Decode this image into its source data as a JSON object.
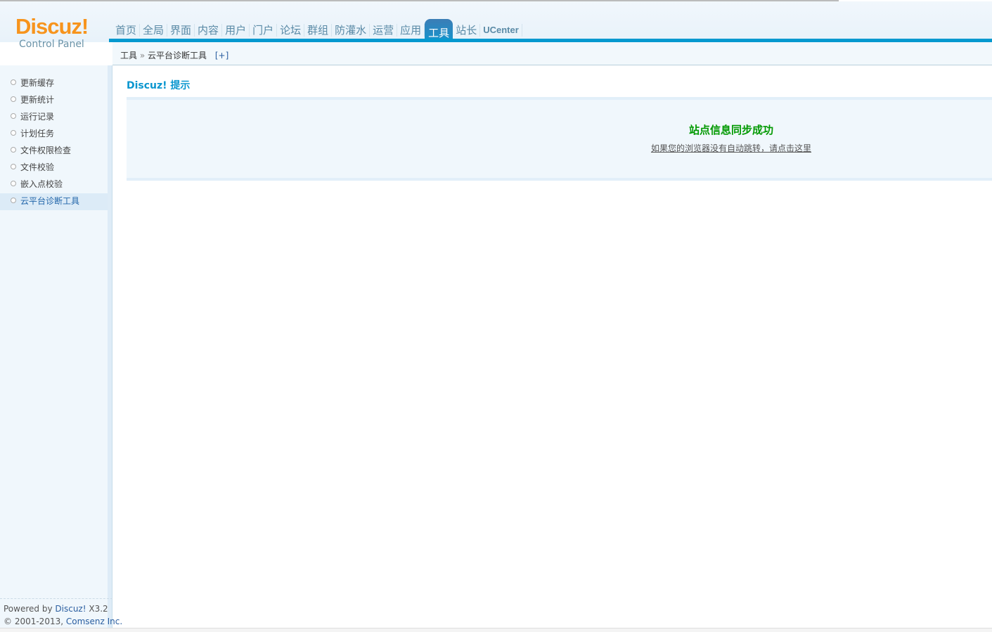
{
  "logo": {
    "brand": "Discuz!",
    "subtitle": "Control Panel"
  },
  "nav": {
    "items": [
      "首页",
      "全局",
      "界面",
      "内容",
      "用户",
      "门户",
      "论坛",
      "群组",
      "防灌水",
      "运营",
      "应用",
      "工具",
      "站长"
    ],
    "ucenter": "UCenter",
    "active": "工具"
  },
  "breadcrumb": {
    "section": "工具",
    "separator": "»",
    "current": "云平台诊断工具",
    "expand": "[+]"
  },
  "sidebar": {
    "items": [
      "更新缓存",
      "更新统计",
      "运行记录",
      "计划任务",
      "文件权限检查",
      "文件校验",
      "嵌入点校验",
      "云平台诊断工具"
    ],
    "active_index": 7
  },
  "footer": {
    "powered_prefix": "Powered by",
    "powered_link": "Discuz!",
    "version": "X3.2",
    "copyright": "© 2001-2013,",
    "company": "Comsenz Inc."
  },
  "main": {
    "title": "Discuz! 提示",
    "message": "站点信息同步成功",
    "redirect_link": "如果您的浏览器没有自动跳转，请点击这里"
  }
}
